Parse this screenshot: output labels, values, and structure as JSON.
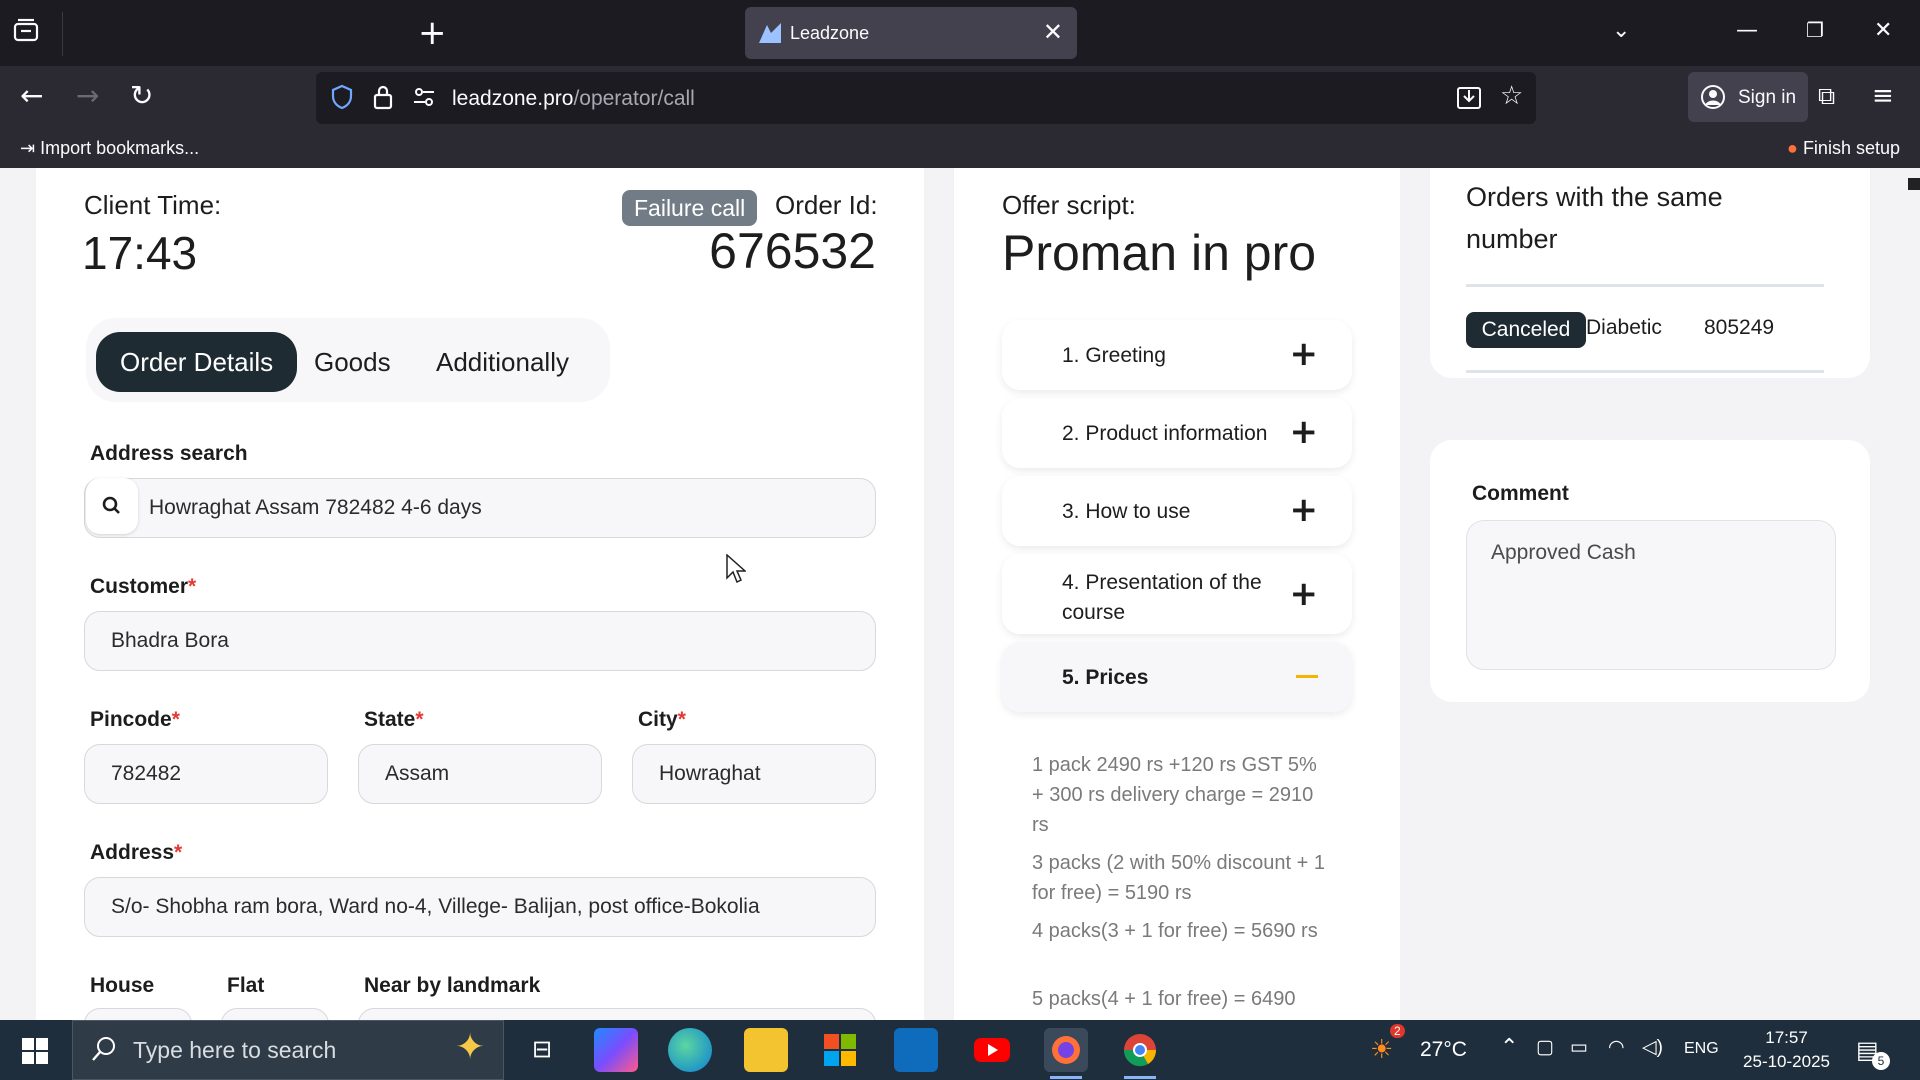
{
  "browser": {
    "tab_title": "Leadzone",
    "url_host": "leadzone.pro",
    "url_path": "/operator/call",
    "signin_label": "Sign in",
    "import_bookmarks": "Import bookmarks...",
    "finish_setup": "Finish setup"
  },
  "header": {
    "client_time_label": "Client Time:",
    "client_time": "17:43",
    "failure_badge": "Failure call",
    "order_id_label": "Order Id:",
    "order_id": "676532"
  },
  "tabs": [
    "Order Details",
    "Goods",
    "Additionally"
  ],
  "form": {
    "address_search_label": "Address search",
    "address_search_value": "Howraghat Assam 782482 4-6 days",
    "customer_label": "Customer",
    "customer_value": "Bhadra Bora",
    "pincode_label": "Pincode",
    "pincode_value": "782482",
    "state_label": "State",
    "state_value": "Assam",
    "city_label": "City",
    "city_value": "Howraghat",
    "address_label": "Address",
    "address_value": "S/o- Shobha ram bora, Ward no-4, Villege- Balijan, post office-Bokolia",
    "house_label": "House",
    "flat_label": "Flat",
    "landmark_label": "Near by landmark",
    "required_mark": "*"
  },
  "offer": {
    "label": "Offer script:",
    "title": "Proman in pro",
    "sections": [
      "1. Greeting",
      "2. Product information",
      "3. How to use",
      "4. Presentation of the course",
      "5. Prices"
    ],
    "prices": [
      "1 pack 2490 rs +120 rs GST 5% + 300 rs delivery charge = 2910 rs",
      "3 packs (2 with 50% discount + 1 for free) = 5190 rs",
      "4 packs(3 + 1 for free) = 5690 rs",
      "5 packs(4 + 1 for free) = 6490"
    ]
  },
  "orders_same_number": {
    "title": "Orders with the same number",
    "rows": [
      {
        "status": "Canceled",
        "product": "Diabetic",
        "order_id": "805249"
      }
    ]
  },
  "comment": {
    "label": "Comment",
    "value": "Approved Cash"
  },
  "taskbar": {
    "search_placeholder": "Type here to search",
    "weather_temp": "27°C",
    "weather_badge": "2",
    "language": "ENG",
    "time": "17:57",
    "date": "25-10-2025",
    "notifications": "5"
  },
  "colors": {
    "dark_accent": "#1e2b33",
    "failure_badge": "#727c86",
    "required": "#e53935",
    "minus_accent": "#f4b400"
  }
}
